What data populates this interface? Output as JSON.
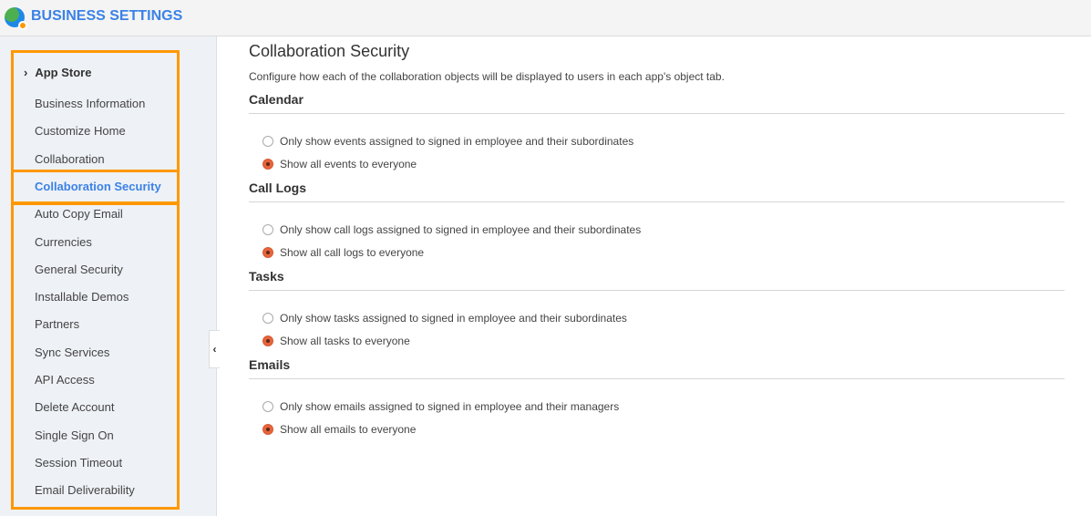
{
  "header": {
    "title": "BUSINESS SETTINGS",
    "logo_icon": "globe-gear-icon"
  },
  "sidebar": {
    "group": "App Store",
    "items": [
      {
        "label": "Business Information"
      },
      {
        "label": "Customize Home"
      },
      {
        "label": "Collaboration"
      },
      {
        "label": "Collaboration Security",
        "active": true
      },
      {
        "label": "Auto Copy Email"
      },
      {
        "label": "Currencies"
      },
      {
        "label": "General Security"
      },
      {
        "label": "Installable Demos"
      },
      {
        "label": "Partners"
      },
      {
        "label": "Sync Services"
      },
      {
        "label": "API Access"
      },
      {
        "label": "Delete Account"
      },
      {
        "label": "Single Sign On"
      },
      {
        "label": "Session Timeout"
      },
      {
        "label": "Email Deliverability"
      }
    ],
    "highlight_color": "#ff9800",
    "active_color": "#3b82e6"
  },
  "main": {
    "title": "Collaboration Security",
    "description": "Configure how each of the collaboration objects will be displayed to users in each app's object tab.",
    "sections": [
      {
        "title": "Calendar",
        "options": [
          {
            "label": "Only show events assigned to signed in employee and their subordinates",
            "selected": false
          },
          {
            "label": "Show all events to everyone",
            "selected": true
          }
        ]
      },
      {
        "title": "Call Logs",
        "options": [
          {
            "label": "Only show call logs assigned to signed in employee and their subordinates",
            "selected": false
          },
          {
            "label": "Show all call logs to everyone",
            "selected": true
          }
        ]
      },
      {
        "title": "Tasks",
        "options": [
          {
            "label": "Only show tasks assigned to signed in employee and their subordinates",
            "selected": false
          },
          {
            "label": "Show all tasks to everyone",
            "selected": true
          }
        ]
      },
      {
        "title": "Emails",
        "options": [
          {
            "label": "Only show emails assigned to signed in employee and their managers",
            "selected": false
          },
          {
            "label": "Show all emails to everyone",
            "selected": true
          }
        ]
      }
    ]
  }
}
